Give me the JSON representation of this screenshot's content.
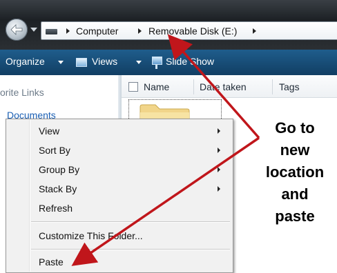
{
  "address_bar": {
    "crumbs": [
      "Computer",
      "Removable Disk (E:)"
    ]
  },
  "toolbar": {
    "organize_label": "Organize",
    "views_label": "Views",
    "slideshow_label": "Slide Show"
  },
  "left_pane": {
    "favorite_links_label": "orite Links",
    "documents_label": "Documents"
  },
  "columns": {
    "name": "Name",
    "date_taken": "Date taken",
    "tags": "Tags"
  },
  "context_menu": {
    "items": [
      {
        "label": "View",
        "has_submenu": true
      },
      {
        "label": "Sort By",
        "has_submenu": true
      },
      {
        "label": "Group By",
        "has_submenu": true
      },
      {
        "label": "Stack By",
        "has_submenu": true
      },
      {
        "label": "Refresh",
        "has_submenu": false
      },
      {
        "label": "Customize This Folder...",
        "has_submenu": false
      },
      {
        "label": "Paste",
        "has_submenu": false
      }
    ]
  },
  "callout": {
    "lines": [
      "Go to",
      "new",
      "location",
      "and",
      "paste"
    ]
  },
  "colors": {
    "arrow": "#c0161b",
    "toolbar": "#1a4f7a",
    "link": "#1a5fb4",
    "folder": "#f1d58a"
  },
  "icons": [
    "back-arrow-icon",
    "drive-icon",
    "views-icon",
    "slideshow-icon",
    "folder-icon",
    "chevron-right-icon"
  ]
}
